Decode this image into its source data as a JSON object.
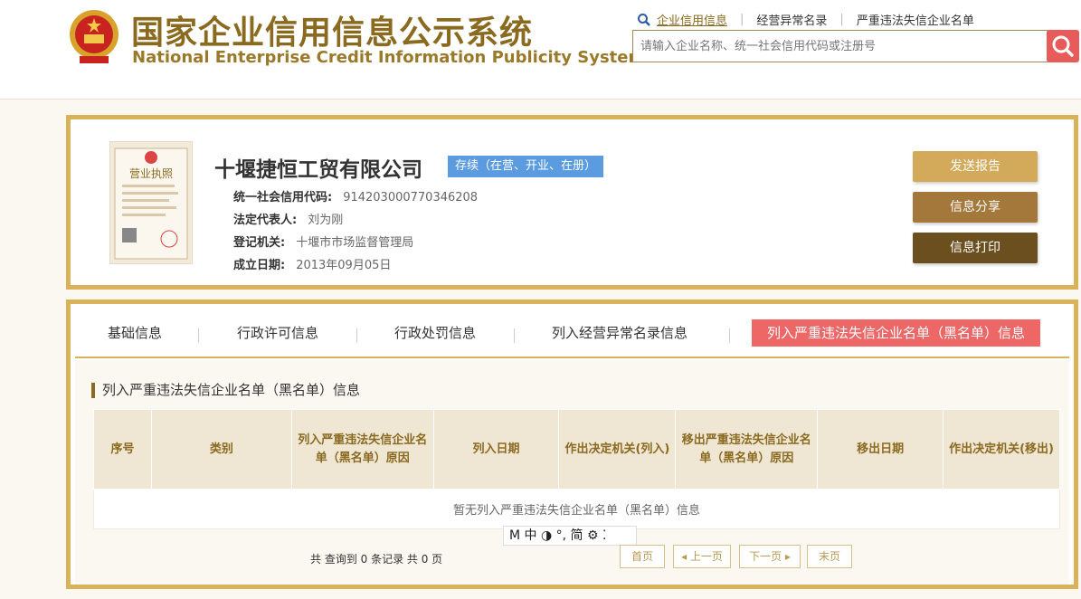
{
  "header": {
    "title_cn": "国家企业信用信息公示系统",
    "title_en": "National Enterprise Credit Information Publicity System",
    "links": [
      "企业信用信息",
      "经营异常名录",
      "严重违法失信企业名单"
    ],
    "search_placeholder": "请输入企业名称、统一社会信用代码或注册号",
    "icons": {
      "emblem": "national-emblem-icon",
      "search": "search-icon",
      "magnifier": "magnifier-icon"
    }
  },
  "company": {
    "name": "十堰捷恒工贸有限公司",
    "status": "存续（在营、开业、在册）",
    "license_title": "营业执照",
    "fields": [
      {
        "key": "统一社会信用代码:",
        "value": "914203000770346208"
      },
      {
        "key": "法定代表人:",
        "value": "刘为刚"
      },
      {
        "key": "登记机关:",
        "value": "十堰市市场监督管理局"
      },
      {
        "key": "成立日期:",
        "value": "2013年09月05日"
      }
    ],
    "buttons": [
      "发送报告",
      "信息分享",
      "信息打印"
    ],
    "button_colors": [
      "#d3a95a",
      "#a3783a",
      "#6b4f1f"
    ]
  },
  "tabs": {
    "items": [
      "基础信息",
      "行政许可信息",
      "行政处罚信息",
      "列入经营异常名录信息",
      "列入严重违法失信企业名单（黑名单）信息"
    ],
    "active_index": 4
  },
  "section": {
    "title": "列入严重违法失信企业名单（黑名单）信息",
    "columns": [
      "序号",
      "类别",
      "列入严重违法失信企业名单（黑名单）原因",
      "列入日期",
      "作出决定机关(列入)",
      "移出严重违法失信企业名单（黑名单）原因",
      "移出日期",
      "作出决定机关(移出)"
    ],
    "empty_text": "暂无列入严重违法失信企业名单（黑名单）信息"
  },
  "ime_bar": "M 中 ◑ °, 简 ⚙ ⁚",
  "pagination": {
    "info": "共 查询到 0 条记录 共 0 页",
    "first": "首页",
    "prev": "◂ 上一页",
    "next": "下一页 ▸",
    "last": "末页"
  }
}
